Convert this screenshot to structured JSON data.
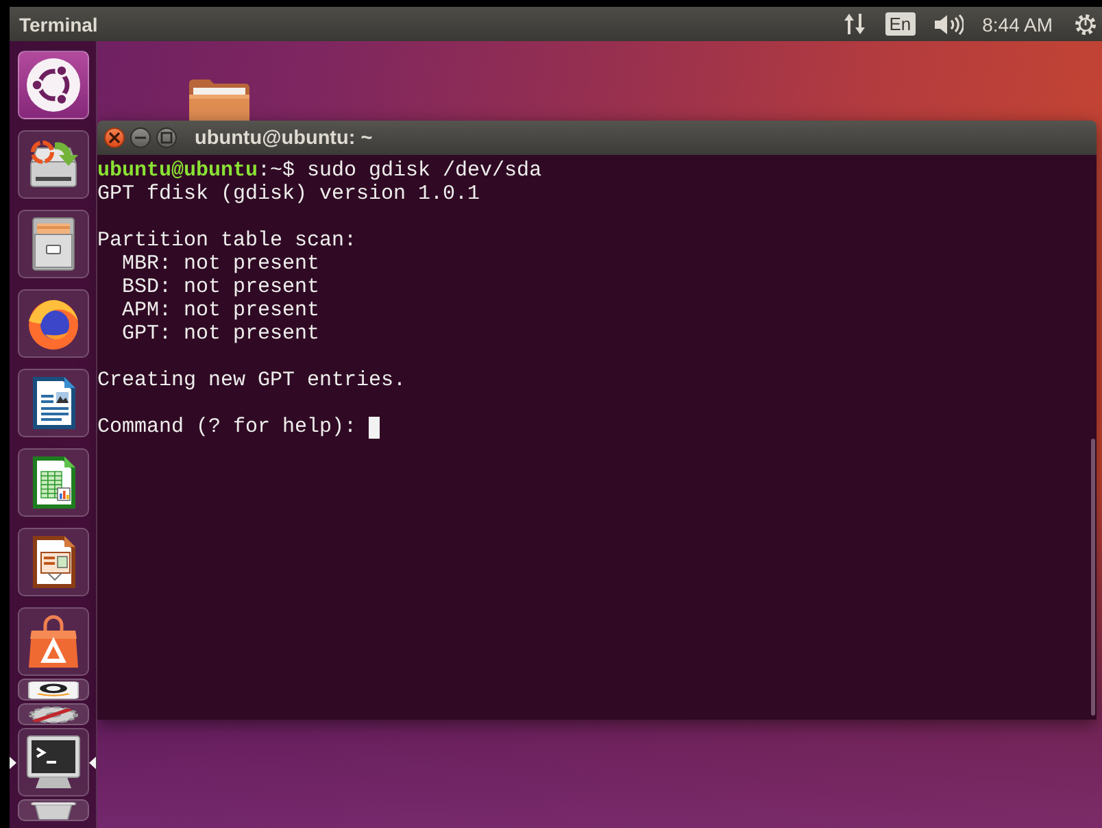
{
  "panel": {
    "title": "Terminal",
    "keyboard_layout": "En",
    "clock": "8:44 AM"
  },
  "launcher": {
    "items": [
      {
        "kind": "dash",
        "folded": false,
        "active": false
      },
      {
        "kind": "updater",
        "folded": false,
        "active": false
      },
      {
        "kind": "files",
        "folded": false,
        "active": false
      },
      {
        "kind": "browser",
        "folded": false,
        "active": false
      },
      {
        "kind": "writer",
        "folded": false,
        "active": false
      },
      {
        "kind": "calc",
        "folded": false,
        "active": false
      },
      {
        "kind": "impress",
        "folded": false,
        "active": false
      },
      {
        "kind": "software",
        "folded": false,
        "active": false
      },
      {
        "kind": "store",
        "folded": true,
        "active": false
      },
      {
        "kind": "settings",
        "folded": true,
        "active": false
      },
      {
        "kind": "terminal",
        "folded": false,
        "active": true
      },
      {
        "kind": "trash",
        "folded": true,
        "active": false
      }
    ]
  },
  "terminal": {
    "title": "ubuntu@ubuntu: ~",
    "prompt": "**ubuntu@ubuntu**:~$ sudo gdisk /dev/sda",
    "output": [
      {
        "text": "GPT fdisk (gdisk) version 1.0.1"
      },
      {
        "text": "Partition table scan:",
        "children": [
          {
            "text": "MBR: not present"
          },
          {
            "text": "BSD: not present"
          },
          {
            "text": "APM: not present"
          },
          {
            "text": "GPT: not present"
          }
        ]
      },
      {
        "text": "Creating new GPT entries."
      }
    ],
    "input_prompt": "Command (? for help):"
  }
}
